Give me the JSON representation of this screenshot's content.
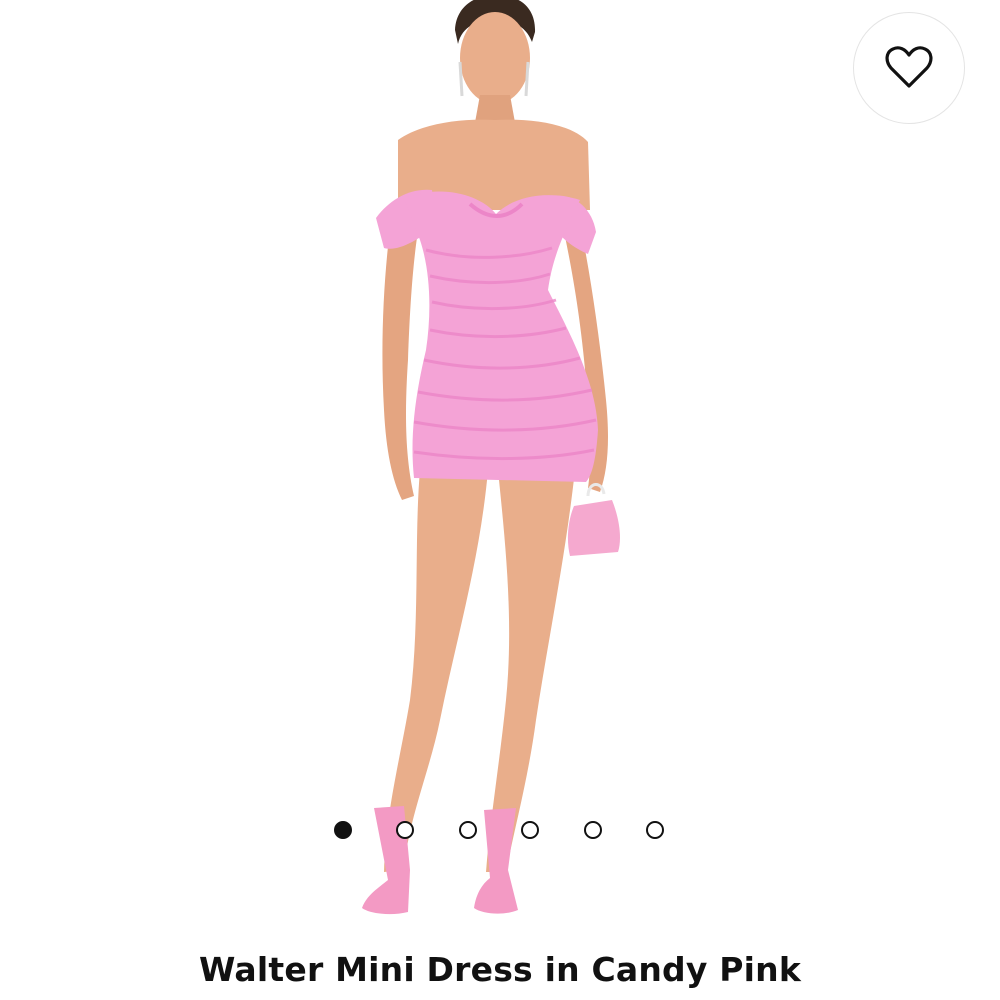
{
  "product": {
    "title": "Walter Mini Dress in Candy Pink",
    "image_subject": "model-wearing-pink-off-shoulder-ruched-mini-dress",
    "dress_color": "#f4a3d6",
    "dress_shade_color": "#ec86c8",
    "skin_color": "#e9ae8b",
    "hair_color": "#3a2a20",
    "bag_color": "#f5a9cf"
  },
  "wishlist": {
    "icon": "heart-outline-icon",
    "saved": false
  },
  "gallery": {
    "total_images": 6,
    "current_index": 1
  }
}
